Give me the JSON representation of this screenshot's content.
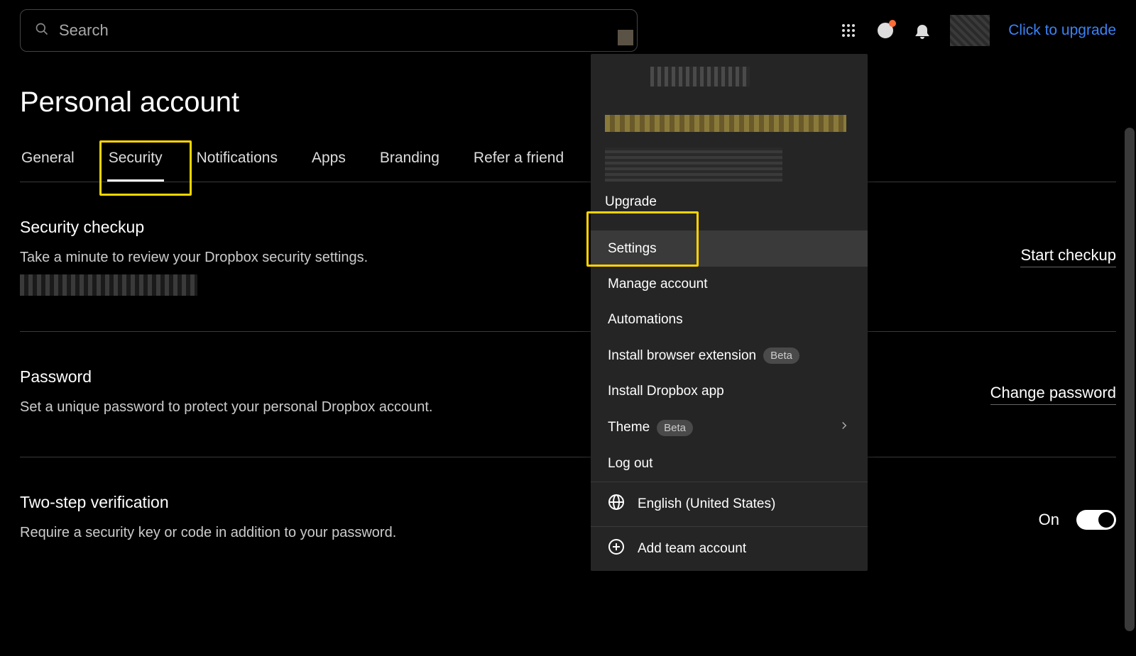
{
  "search": {
    "placeholder": "Search"
  },
  "header": {
    "upgrade_link": "Click to upgrade"
  },
  "page_title": "Personal account",
  "tabs": {
    "general": "General",
    "security": "Security",
    "notifications": "Notifications",
    "apps": "Apps",
    "branding": "Branding",
    "refer": "Refer a friend"
  },
  "sections": {
    "checkup": {
      "title": "Security checkup",
      "desc": "Take a minute to review your Dropbox security settings.",
      "action": "Start checkup"
    },
    "password": {
      "title": "Password",
      "desc": "Set a unique password to protect your personal Dropbox account.",
      "action": "Change password"
    },
    "twostep": {
      "title": "Two-step verification",
      "desc": "Require a security key or code in addition to your password.",
      "state_label": "On"
    }
  },
  "dropdown": {
    "upgrade": "Upgrade",
    "settings": "Settings",
    "manage_account": "Manage account",
    "automations": "Automations",
    "install_ext": "Install browser extension",
    "install_app": "Install Dropbox app",
    "theme": "Theme",
    "logout": "Log out",
    "language": "English (United States)",
    "add_team": "Add team account",
    "beta": "Beta"
  }
}
